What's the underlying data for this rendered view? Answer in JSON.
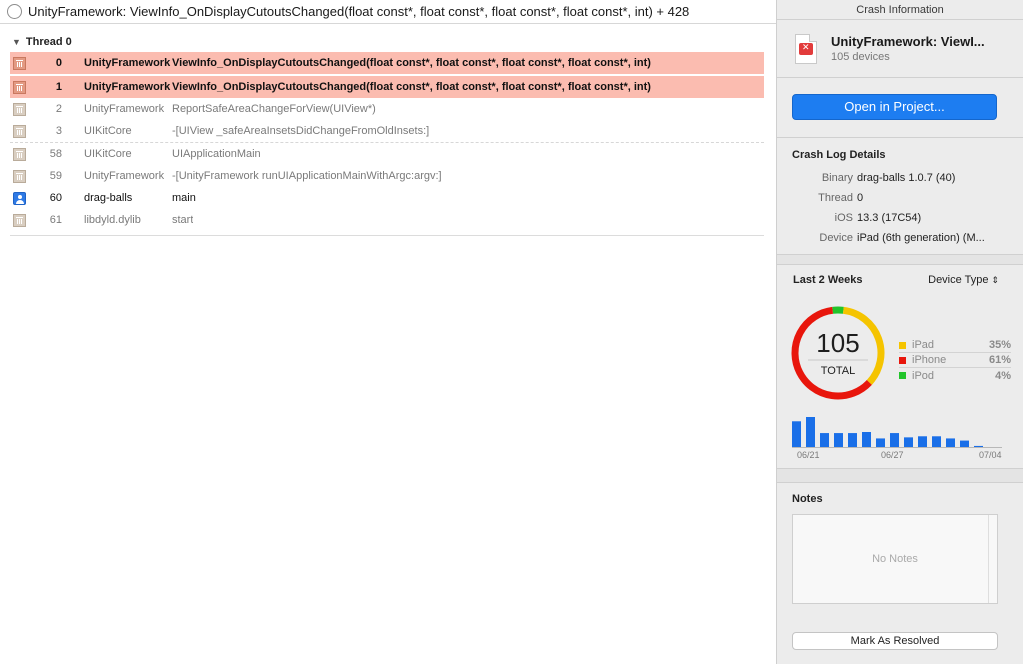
{
  "frame_header": {
    "title": "UnityFramework: ViewInfo_OnDisplayCutoutsChanged(float const*, float const*, float const*, float const*, int) + 428"
  },
  "thread": {
    "label": "Thread 0",
    "frames": [
      {
        "num": "0",
        "library": "UnityFramework",
        "function": "ViewInfo_OnDisplayCutoutsChanged(float const*, float const*, float const*, float const*, int)",
        "kind": "crashed"
      },
      {
        "num": "1",
        "library": "UnityFramework",
        "function": "ViewInfo_OnDisplayCutoutsChanged(float const*, float const*, float const*, float const*, int)",
        "kind": "crashed"
      },
      {
        "num": "2",
        "library": "UnityFramework",
        "function": "ReportSafeAreaChangeForView(UIView*)",
        "kind": "system"
      },
      {
        "num": "3",
        "library": "UIKitCore",
        "function": "-[UIView _safeAreaInsetsDidChangeFromOldInsets:]",
        "kind": "system"
      },
      {
        "num": "58",
        "library": "UIKitCore",
        "function": "UIApplicationMain",
        "kind": "system"
      },
      {
        "num": "59",
        "library": "UnityFramework",
        "function": "-[UnityFramework runUIApplicationMainWithArgc:argv:]",
        "kind": "system"
      },
      {
        "num": "60",
        "library": "drag-balls",
        "function": "main",
        "kind": "user"
      },
      {
        "num": "61",
        "library": "libdyld.dylib",
        "function": "start",
        "kind": "system"
      }
    ]
  },
  "inspector": {
    "title": "Crash Information",
    "crash_name": "UnityFramework: ViewI...",
    "device_count": "105 devices",
    "open_button": "Open in Project...",
    "details_title": "Crash Log Details",
    "details": [
      {
        "key": "Binary",
        "value": "drag-balls 1.0.7 (40)"
      },
      {
        "key": "Thread",
        "value": "0"
      },
      {
        "key": "iOS",
        "value": "13.3 (17C54)"
      },
      {
        "key": "Device",
        "value": "iPad (6th generation) (M..."
      }
    ],
    "weeks_title": "Last 2 Weeks",
    "device_type_select": "Device Type",
    "notes_title": "Notes",
    "notes_empty": "No Notes",
    "resolve_button": "Mark As Resolved"
  },
  "colors": {
    "crashed_row": "#fbbcb0",
    "accent": "#1d7df1",
    "ipad": "#f5c400",
    "iphone": "#e8160c",
    "ipod": "#22c42a",
    "bars": "#1a6fe8"
  },
  "chart_data": [
    {
      "type": "pie",
      "center_value": "105",
      "center_label": "TOTAL",
      "categories": [
        "iPad",
        "iPhone",
        "iPod"
      ],
      "values": [
        35,
        61,
        4
      ],
      "labels": [
        "35%",
        "61%",
        "4%"
      ]
    },
    {
      "type": "bar",
      "x_ticks": [
        "06/21",
        "06/27",
        "07/04"
      ],
      "values": [
        24,
        28,
        13,
        13,
        13,
        14,
        8,
        13,
        9,
        10,
        10,
        8,
        6,
        1
      ]
    }
  ]
}
